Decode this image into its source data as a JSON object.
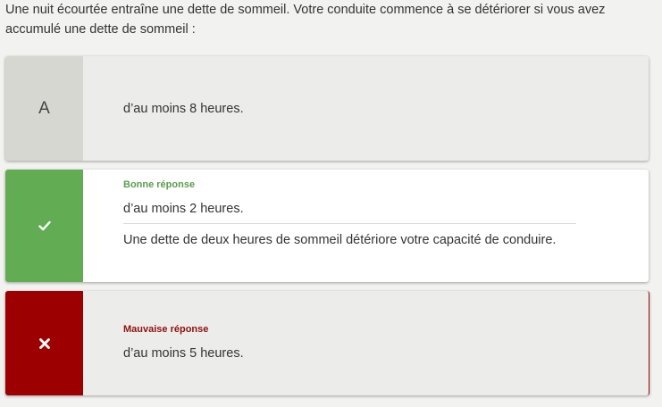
{
  "question": {
    "text": "Une nuit écourtée entraîne une dette de sommeil. Votre conduite commence à se détériorer si vous avez accumulé une dette de sommeil :"
  },
  "answers": [
    {
      "letter": "A",
      "text": "d’au moins 8 heures.",
      "state": "neutral"
    },
    {
      "icon": "check-icon",
      "status_label": "Bonne réponse",
      "text": "d’au moins 2 heures.",
      "explanation": "Une dette de deux heures de sommeil détériore votre capacité de conduire.",
      "state": "correct"
    },
    {
      "icon": "cross-icon",
      "status_label": "Mauvaise réponse",
      "text": "d’au moins 5 heures.",
      "state": "wrong"
    }
  ],
  "colors": {
    "correct": "#62ac54",
    "wrong": "#9c0000",
    "neutral_side": "#d6d7d0",
    "card_bg": "#ecedea"
  }
}
